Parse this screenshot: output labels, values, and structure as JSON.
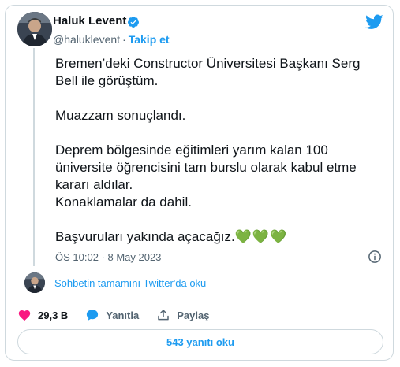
{
  "author": {
    "name": "Haluk Levent",
    "handle": "@haluklevent",
    "separator": "·",
    "follow_label": "Takip et"
  },
  "tweet": {
    "text": "Bremen’deki Constructor Üniversitesi Başkanı Serg Bell ile görüştüm.\n\nMuazzam sonuçlandı.\n\nDeprem bölgesinde eğitimleri yarım kalan 100 üniversite öğrencisini tam burslu olarak kabul etme kararı aldılar.\nKonaklamalar da dahil.\n\nBaşvuruları yakında açacağız.",
    "emoji": "💚💚💚",
    "timestamp": "ÖS 10:02 · 8 May 2023"
  },
  "thread_link": "Sohbetin tamamını Twitter'da oku",
  "actions": {
    "likes": "29,3 B",
    "reply_label": "Yanıtla",
    "share_label": "Paylaş"
  },
  "replies_button": "543 yanıtı oku",
  "icons": {
    "verified": "verified-badge-icon",
    "brand": "twitter-bird-icon",
    "info": "info-icon",
    "like": "heart-icon",
    "reply": "reply-bubble-icon",
    "share": "share-icon"
  },
  "colors": {
    "accent": "#1d9bf0",
    "like": "#f91880",
    "secondary_text": "#536471",
    "border": "#cfd9de",
    "heart_emoji": "#78b159"
  }
}
